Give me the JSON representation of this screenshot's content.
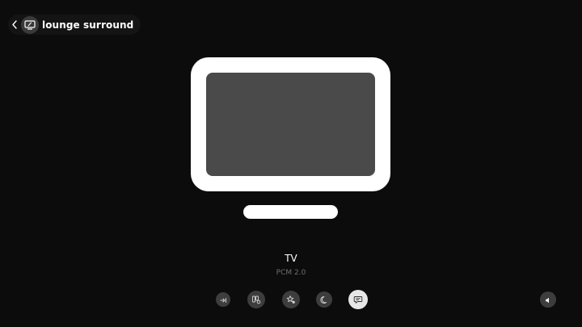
{
  "header": {
    "room_name": "lounge surround"
  },
  "now_playing": {
    "source": "TV",
    "format": "PCM 2.0"
  },
  "controls": [
    {
      "name": "input-icon"
    },
    {
      "name": "speaker-grid-settings-icon"
    },
    {
      "name": "sound-effects-icon"
    },
    {
      "name": "night-mode-icon"
    },
    {
      "name": "speech-enhancement-icon",
      "active": true
    }
  ],
  "colors": {
    "background": "#0c0c0c",
    "tv_frame": "#ffffff",
    "tv_screen": "#4a4a4a",
    "button": "#3d3d3d",
    "button_active": "#e6e6e6",
    "secondary_text": "#6e6e6e"
  }
}
